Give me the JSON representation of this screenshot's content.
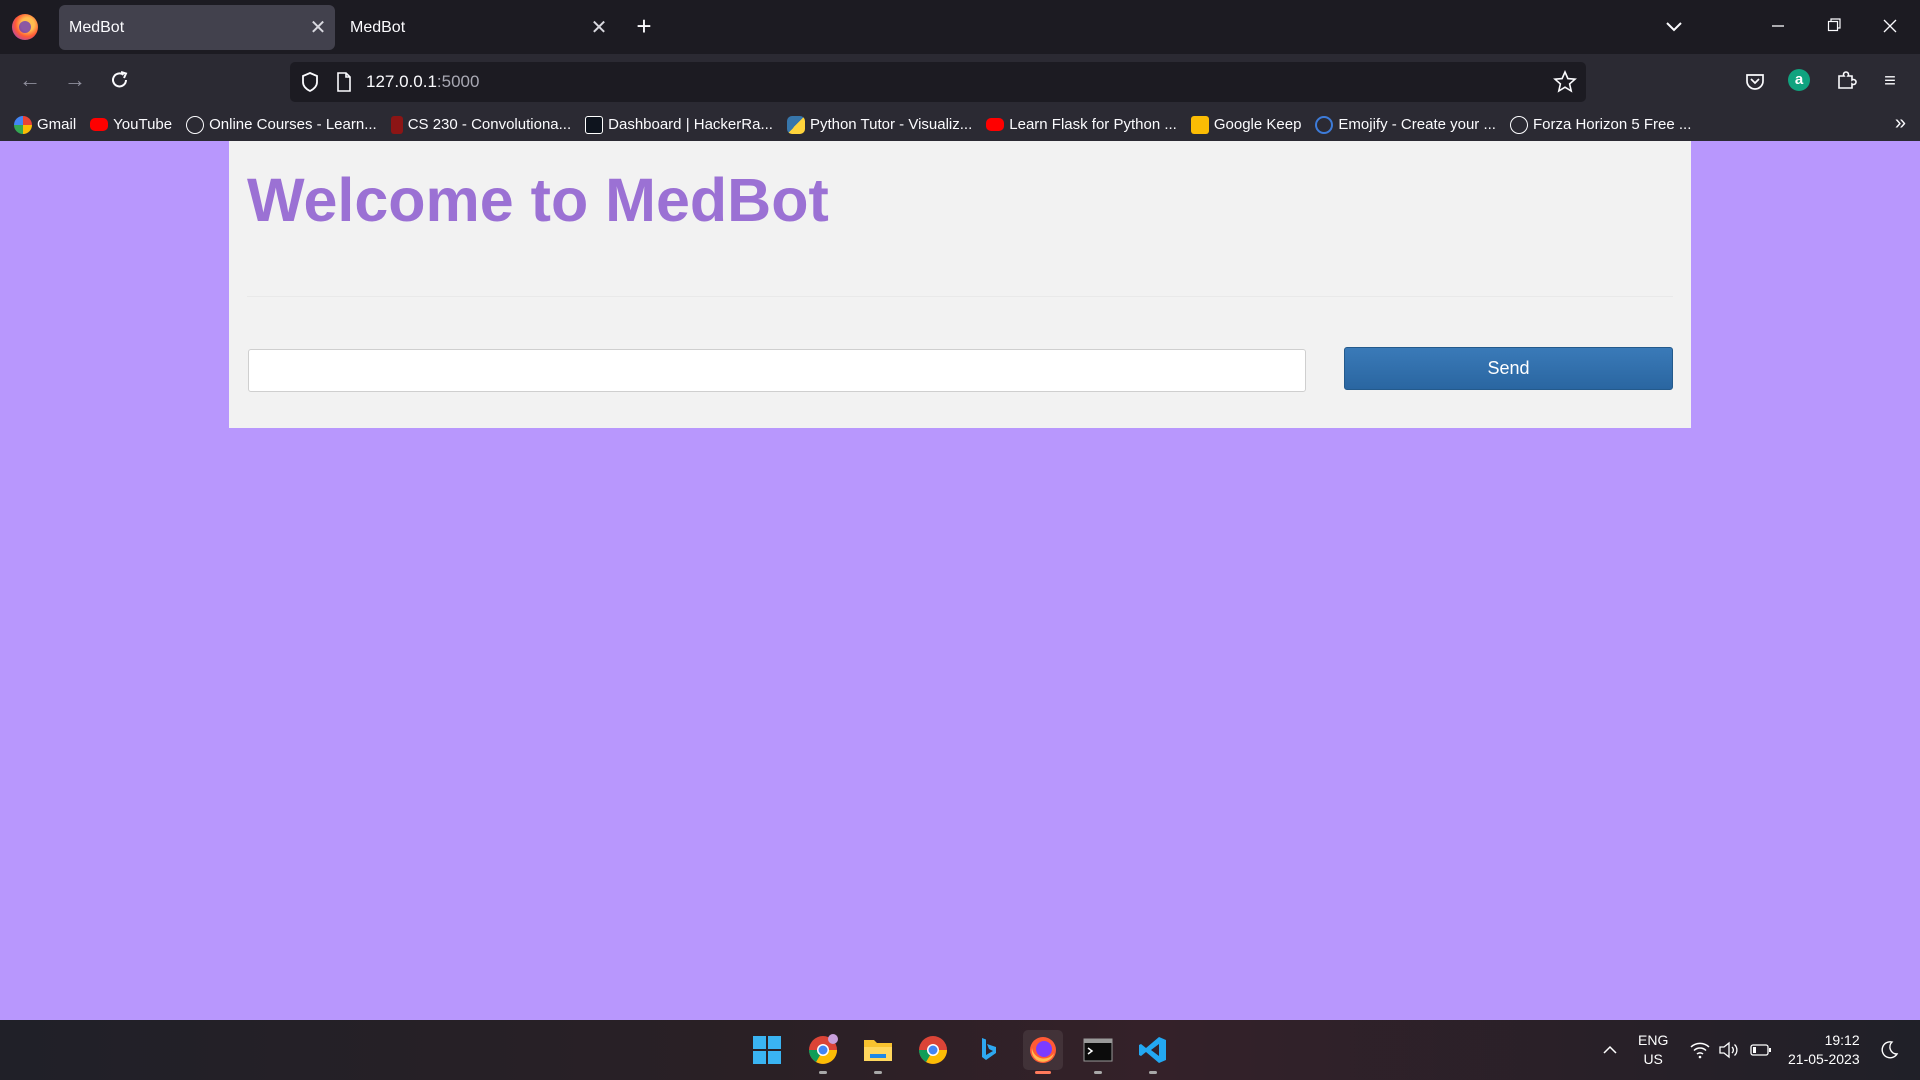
{
  "browser": {
    "tabs": [
      {
        "title": "MedBot",
        "active": true
      },
      {
        "title": "MedBot",
        "active": false
      }
    ],
    "new_tab_icon": "+",
    "url": {
      "host": "127.0.0.1",
      "port": ":5000"
    },
    "bookmarks": [
      {
        "label": "Gmail",
        "icon": "google-icon",
        "color": "#ffffff"
      },
      {
        "label": "YouTube",
        "icon": "youtube-icon",
        "color": "#ff0000"
      },
      {
        "label": "Online Courses - Learn...",
        "icon": "globe-icon",
        "color": "#2b2a33"
      },
      {
        "label": "CS 230 - Convolutiona...",
        "icon": "stanford-icon",
        "color": "#8c1515"
      },
      {
        "label": "Dashboard | HackerRa...",
        "icon": "hackerrank-icon",
        "color": "#0e141e"
      },
      {
        "label": "Python Tutor - Visualiz...",
        "icon": "python-icon",
        "color": "#3776ab"
      },
      {
        "label": "Learn Flask for Python ...",
        "icon": "youtube-icon",
        "color": "#ff0000"
      },
      {
        "label": "Google Keep",
        "icon": "keep-icon",
        "color": "#fbbc04"
      },
      {
        "label": "Emojify - Create your ...",
        "icon": "emojify-icon",
        "color": "#3d7bd9"
      },
      {
        "label": "Forza Horizon 5 Free ...",
        "icon": "globe-icon",
        "color": "#2b2a33"
      }
    ]
  },
  "page": {
    "title": "Welcome to MedBot",
    "input": {
      "value": "",
      "placeholder": ""
    },
    "send_label": "Send"
  },
  "taskbar": {
    "apps": [
      "windows-start-icon",
      "chrome-profile-icon",
      "file-explorer-icon",
      "chrome-icon",
      "bing-icon",
      "firefox-icon",
      "terminal-icon",
      "vscode-icon"
    ],
    "lang_top": "ENG",
    "lang_bottom": "US",
    "time": "19:12",
    "date": "21-05-2023"
  }
}
